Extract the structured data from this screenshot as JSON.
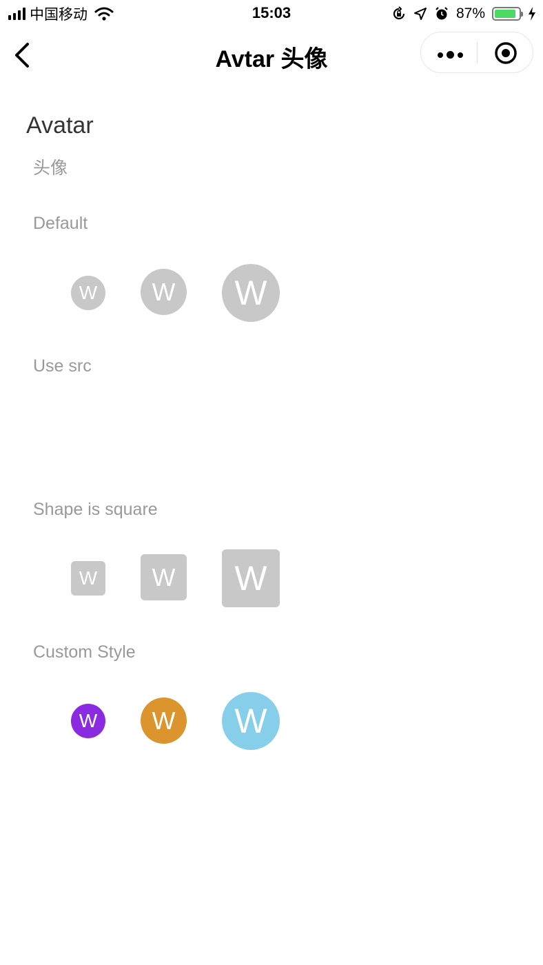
{
  "status_bar": {
    "carrier": "中国移动",
    "time": "15:03",
    "battery_percent": "87%",
    "battery_level": 0.87,
    "icons": [
      "signal-icon",
      "wifi-icon",
      "orientation-lock-icon",
      "location-icon",
      "alarm-icon",
      "battery-icon",
      "charging-icon"
    ]
  },
  "nav": {
    "title": "Avtar 头像",
    "icons": [
      "back-chevron-icon",
      "more-dots-icon",
      "close-circle-icon"
    ]
  },
  "page": {
    "title": "Avatar",
    "subtitle": "头像"
  },
  "sections": {
    "default": {
      "label": "Default",
      "avatars": [
        {
          "text": "W",
          "size": "small",
          "color": "#c8c8c8"
        },
        {
          "text": "W",
          "size": "default",
          "color": "#c8c8c8"
        },
        {
          "text": "W",
          "size": "large",
          "color": "#c8c8c8"
        }
      ]
    },
    "use_src": {
      "label": "Use src"
    },
    "square": {
      "label": "Shape is square",
      "avatars": [
        {
          "text": "W",
          "size": "small",
          "color": "#c8c8c8"
        },
        {
          "text": "W",
          "size": "default",
          "color": "#c8c8c8"
        },
        {
          "text": "W",
          "size": "large",
          "color": "#c8c8c8"
        }
      ]
    },
    "custom": {
      "label": "Custom Style",
      "avatars": [
        {
          "text": "W",
          "size": "small",
          "color": "#8a2be2"
        },
        {
          "text": "W",
          "size": "default",
          "color": "#dc952e"
        },
        {
          "text": "W",
          "size": "large",
          "color": "#87ceeb"
        }
      ]
    }
  }
}
